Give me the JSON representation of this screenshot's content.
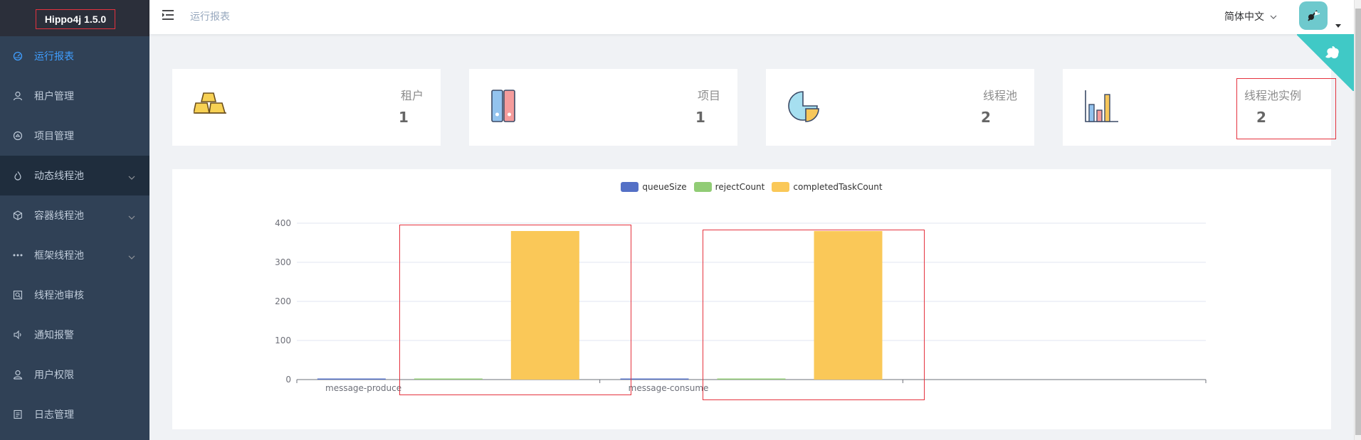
{
  "app": {
    "logo": "Hippo4j 1.5.0"
  },
  "sidebar": {
    "items": [
      {
        "label": "运行报表",
        "icon": "dashboard-icon",
        "active": true
      },
      {
        "label": "租户管理",
        "icon": "user-icon"
      },
      {
        "label": "项目管理",
        "icon": "project-icon"
      },
      {
        "label": "动态线程池",
        "icon": "flame-icon",
        "expandable": true
      },
      {
        "label": "容器线程池",
        "icon": "cube-icon",
        "expandable": true
      },
      {
        "label": "框架线程池",
        "icon": "more-icon",
        "expandable": true
      },
      {
        "label": "线程池审核",
        "icon": "audit-icon"
      },
      {
        "label": "通知报警",
        "icon": "speaker-icon"
      },
      {
        "label": "用户权限",
        "icon": "person-icon"
      },
      {
        "label": "日志管理",
        "icon": "log-icon"
      }
    ]
  },
  "header": {
    "breadcrumb": "运行报表",
    "language": "简体中文"
  },
  "cards": [
    {
      "label": "租户",
      "value": "1",
      "icon": "gold-bars-icon"
    },
    {
      "label": "项目",
      "value": "1",
      "icon": "binders-icon"
    },
    {
      "label": "线程池",
      "value": "2",
      "icon": "pie-chart-icon"
    },
    {
      "label": "线程池实例",
      "value": "2",
      "icon": "bar-chart-icon"
    }
  ],
  "chart_data": {
    "type": "bar",
    "categories": [
      "message-produce",
      "message-consume"
    ],
    "series": [
      {
        "name": "queueSize",
        "color": "#5470c6",
        "values": [
          0,
          0
        ]
      },
      {
        "name": "rejectCount",
        "color": "#91cc75",
        "values": [
          0,
          0
        ]
      },
      {
        "name": "completedTaskCount",
        "color": "#fac858",
        "values": [
          380,
          380
        ]
      }
    ],
    "yticks": [
      "0",
      "100",
      "200",
      "300",
      "400"
    ],
    "ylim": [
      0,
      400
    ],
    "legend_position": "top-center",
    "grid": true
  }
}
